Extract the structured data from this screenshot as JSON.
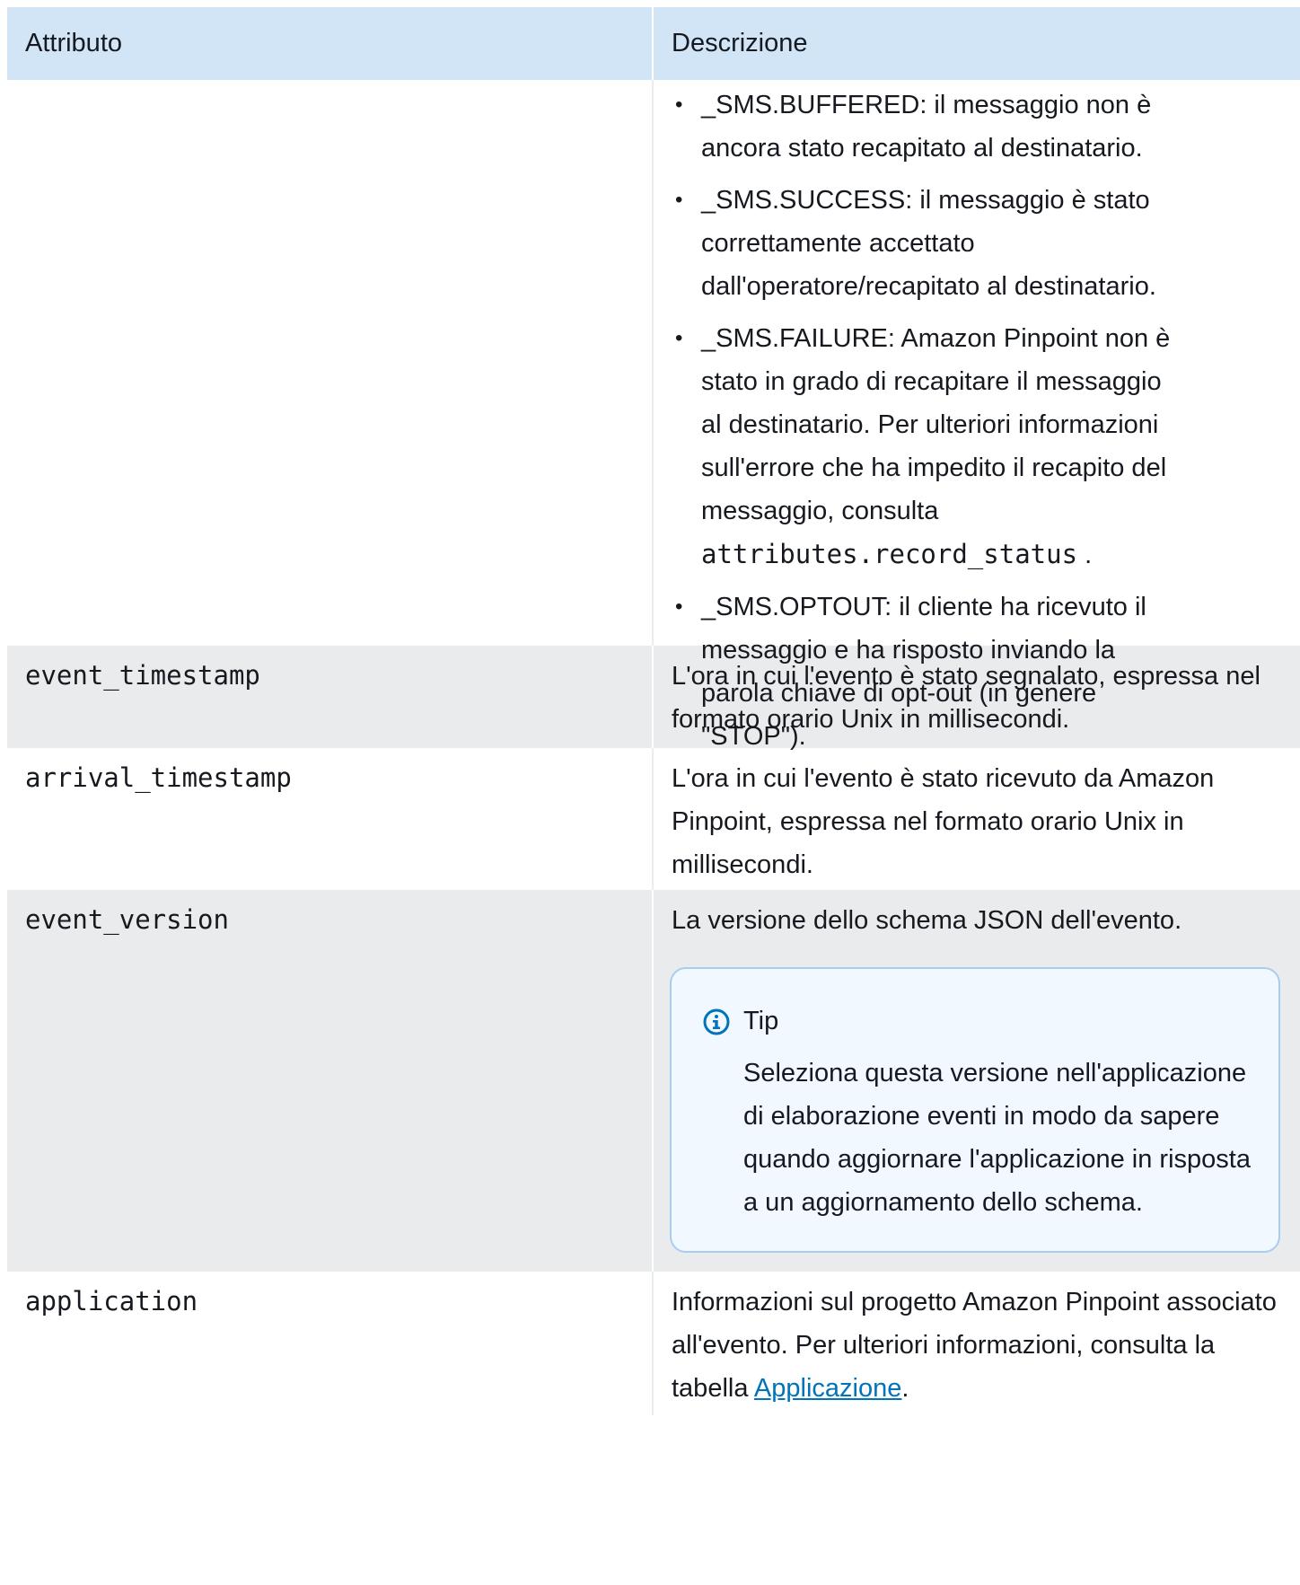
{
  "header": {
    "col_attribute": "Attributo",
    "col_description": "Descrizione"
  },
  "first_row": {
    "bullets": [
      {
        "prefix": "_SMS.BUFFERED: il messaggio non è ancora stato recapitato al destinatario."
      },
      {
        "prefix": "_SMS.SUCCESS: il messaggio è stato correttamente accettato dall'operatore/recapitato al destinatario."
      },
      {
        "prefix": "_SMS.FAILURE: Amazon Pinpoint non è stato in grado di recapitare il messaggio al destinatario. Per ulteriori informazioni sull'errore che ha impedito il recapito del messaggio, consulta ",
        "code": "attributes.record_status",
        "suffix": " ."
      },
      {
        "prefix": "_SMS.OPTOUT: il cliente ha ricevuto il messaggio e ha risposto inviando la parola chiave di opt-out (in genere \"STOP\")."
      }
    ]
  },
  "rows": [
    {
      "attribute": "event_timestamp",
      "description": "L'ora in cui l'evento è stato segnalato, espressa nel formato orario Unix in millisecondi."
    },
    {
      "attribute": "arrival_timestamp",
      "description": "L'ora in cui l'evento è stato ricevuto da Amazon Pinpoint, espressa nel formato orario Unix in millisecondi."
    },
    {
      "attribute": "event_version",
      "description": "La versione dello schema JSON dell'evento.",
      "tip": {
        "title": "Tip",
        "body": "Seleziona questa versione nell'applicazione di elaborazione eventi in modo da sapere quando aggiornare l'applicazione in risposta a un aggiornamento dello schema."
      }
    },
    {
      "attribute": "application",
      "description_prefix": "Informazioni sul progetto Amazon Pinpoint associato all'evento. Per ulteriori informazioni, consulta la tabella ",
      "link_text": "Applicazione",
      "description_suffix": "."
    }
  ],
  "icons": {
    "tip": "info-circle-icon"
  },
  "colors": {
    "header_bg": "#d1e5f6",
    "row_alt_bg": "#eaebed",
    "link": "#0073bb",
    "tip_border": "#a8cdee",
    "tip_bg": "#f1f8ff"
  }
}
